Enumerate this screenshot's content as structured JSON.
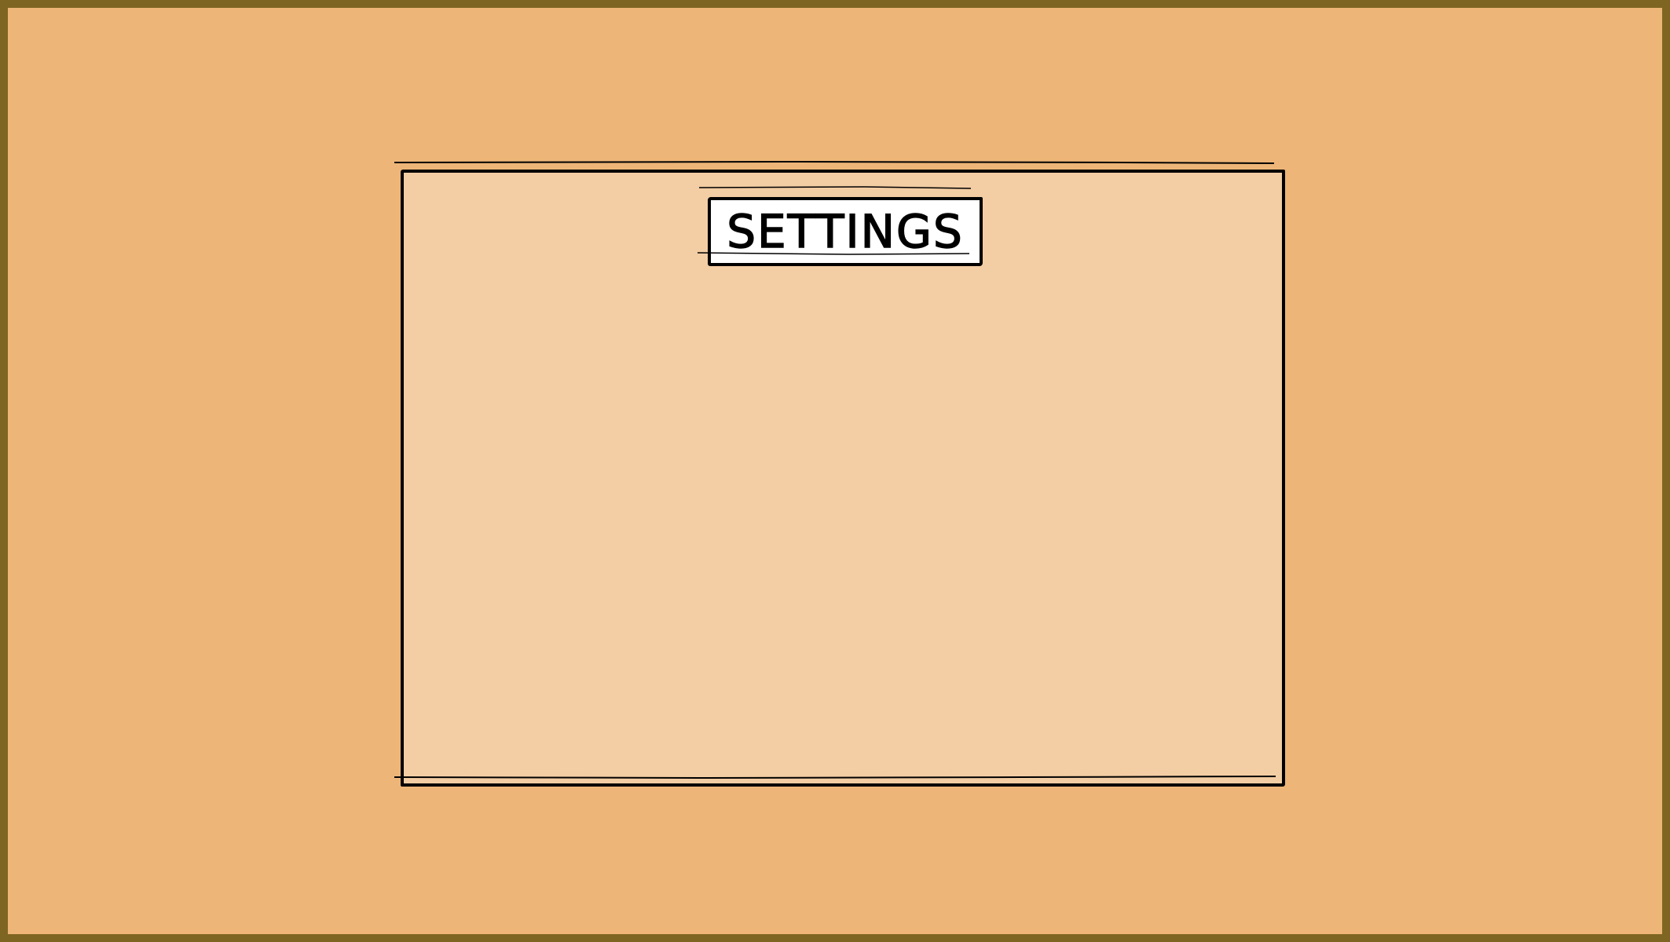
{
  "screen": {
    "background_color": "#edb577",
    "frame_color": "#7f6522"
  },
  "settings_panel": {
    "title": "SETTINGS",
    "panel_color": "#f3cda3",
    "title_plate_color": "#ffffff",
    "outline_color": "#000000"
  }
}
